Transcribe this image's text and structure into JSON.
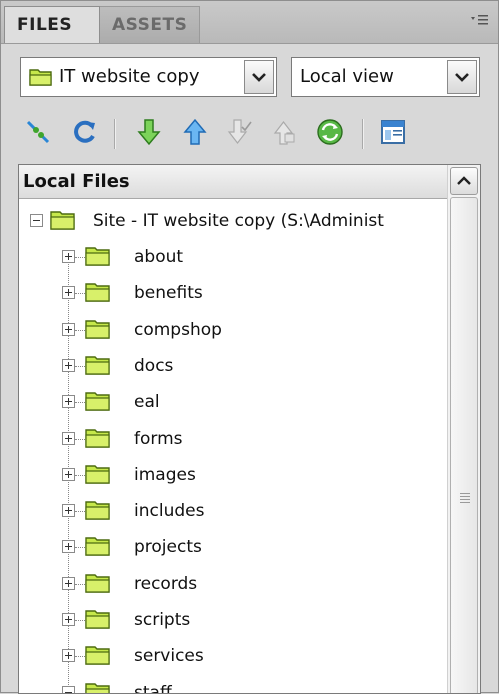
{
  "tabs": [
    {
      "label": "FILES",
      "active": true
    },
    {
      "label": "ASSETS",
      "active": false
    }
  ],
  "panel_menu_icon": "panel-menu-icon",
  "site_select": {
    "value": "IT website copy",
    "icon": "site-folder-icon"
  },
  "view_select": {
    "value": "Local view"
  },
  "toolbar": [
    {
      "name": "connect-icon"
    },
    {
      "name": "refresh-icon"
    },
    {
      "name": "get-files-icon"
    },
    {
      "name": "put-files-icon"
    },
    {
      "name": "check-out-icon"
    },
    {
      "name": "check-in-icon"
    },
    {
      "name": "synchronize-icon"
    },
    {
      "name": "expand-panel-icon"
    }
  ],
  "tree": {
    "header": "Local Files",
    "root": {
      "label": "Site - IT website copy (S:\\Administ",
      "expanded": true
    },
    "folders": [
      {
        "label": "about",
        "expanded": false
      },
      {
        "label": "benefits",
        "expanded": false
      },
      {
        "label": "compshop",
        "expanded": false
      },
      {
        "label": "docs",
        "expanded": false
      },
      {
        "label": "eal",
        "expanded": false
      },
      {
        "label": "forms",
        "expanded": false
      },
      {
        "label": "images",
        "expanded": false
      },
      {
        "label": "includes",
        "expanded": false
      },
      {
        "label": "projects",
        "expanded": false
      },
      {
        "label": "records",
        "expanded": false
      },
      {
        "label": "scripts",
        "expanded": false
      },
      {
        "label": "services",
        "expanded": false
      },
      {
        "label": "staff",
        "expanded": true
      }
    ]
  },
  "colors": {
    "folder_fill": "#c6e84a",
    "folder_edge": "#4d6b10",
    "arrow_green": "#3fa52c",
    "arrow_blue": "#2a86d6"
  }
}
